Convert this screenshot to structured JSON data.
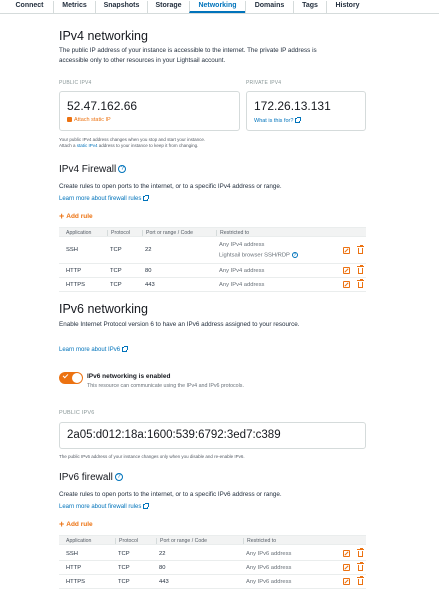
{
  "tabs": [
    "Connect",
    "Metrics",
    "Snapshots",
    "Storage",
    "Networking",
    "Domains",
    "Tags",
    "History"
  ],
  "active_tab": "Networking",
  "ipv4": {
    "title": "IPv4 networking",
    "description": "The public IP address of your instance is accessible to the internet. The private IP address is accessible only to other resources in your Lightsail account.",
    "public_label": "PUBLIC IPV4",
    "public_ip": "52.47.162.66",
    "attach_static_ip": "Attach static IP",
    "private_label": "PRIVATE IPV4",
    "private_ip": "172.26.13.131",
    "what_is_this": "What is this for?",
    "note_line1": "Your public IPv4 address changes when you stop and start your instance.",
    "note_line2_pre": "Attach a ",
    "note_line2_link": "static IPv4",
    "note_line2_post": " address to your instance to keep it from changing."
  },
  "ipv4_firewall": {
    "title": "IPv4 Firewall",
    "description": "Create rules to open ports to the internet, or to a specific IPv4 address or range.",
    "learn_more": "Learn more about firewall rules",
    "add_rule": "Add rule",
    "columns": [
      "Application",
      "Protocol",
      "Port or range / Code",
      "Restricted to"
    ],
    "rows": [
      {
        "application": "SSH",
        "protocol": "TCP",
        "port": "22",
        "restricted": "Any IPv4 address",
        "extra": "Lightsail browser SSH/RDP"
      },
      {
        "application": "HTTP",
        "protocol": "TCP",
        "port": "80",
        "restricted": "Any IPv4 address",
        "extra": ""
      },
      {
        "application": "HTTPS",
        "protocol": "TCP",
        "port": "443",
        "restricted": "Any IPv4 address",
        "extra": ""
      }
    ]
  },
  "ipv6": {
    "title": "IPv6 networking",
    "description": "Enable Internet Protocol version 6 to have an IPv6 address assigned to your resource.",
    "learn_more": "Learn more about IPv6",
    "toggle_label": "IPv6 networking is enabled",
    "toggle_sub": "This resource can communicate using the IPv4 and IPv6 protocols.",
    "public_label": "PUBLIC IPV6",
    "public_ip": "2a05:d012:18a:1600:539:6792:3ed7:c389",
    "note": "The public IPv6 address of your instance changes only when you disable and re-enable IPv6."
  },
  "ipv6_firewall": {
    "title": "IPv6 firewall",
    "description": "Create rules to open ports to the internet, or to a specific IPv6 address or range.",
    "learn_more": "Learn more about firewall rules",
    "add_rule": "Add rule",
    "columns": [
      "Application",
      "Protocol",
      "Port or range / Code",
      "Restricted to"
    ],
    "rows": [
      {
        "application": "SSH",
        "protocol": "TCP",
        "port": "22",
        "restricted": "Any IPv6 address"
      },
      {
        "application": "HTTP",
        "protocol": "TCP",
        "port": "80",
        "restricted": "Any IPv6 address"
      },
      {
        "application": "HTTPS",
        "protocol": "TCP",
        "port": "443",
        "restricted": "Any IPv6 address"
      }
    ]
  },
  "colors": {
    "accent": "#ec7211",
    "link": "#0073bb",
    "active_tab": "#0073bb"
  },
  "icons": {
    "help": "?",
    "edit": "edit-icon",
    "delete": "trash-icon",
    "external": "external-link-icon"
  }
}
